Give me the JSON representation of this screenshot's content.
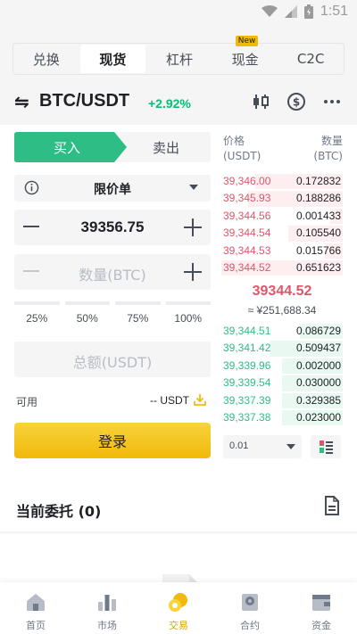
{
  "status_bar": {
    "time": "1:51"
  },
  "tabs": [
    {
      "label": "兑换"
    },
    {
      "label": "现货",
      "active": true
    },
    {
      "label": "杠杆"
    },
    {
      "label": "现金",
      "badge": "New"
    },
    {
      "label": "C2C"
    }
  ],
  "pair": {
    "symbol": "BTC/USDT",
    "change": "+2.92%"
  },
  "trade": {
    "buy_label": "买入",
    "sell_label": "卖出",
    "order_type": "限价单",
    "price_value": "39356.75",
    "amount_placeholder": "数量(BTC)",
    "percentages": [
      "25%",
      "50%",
      "75%",
      "100%"
    ],
    "total_placeholder": "总额(USDT)",
    "available_label": "可用",
    "available_value": "-- USDT",
    "login_label": "登录"
  },
  "orderbook": {
    "price_header": [
      "价格",
      "(USDT)"
    ],
    "qty_header": [
      "数量",
      "(BTC)"
    ],
    "asks": [
      {
        "price": "39,346.00",
        "qty": "0.172832",
        "depth": 0.72
      },
      {
        "price": "39,345.93",
        "qty": "0.188286",
        "depth": 0.78
      },
      {
        "price": "39,344.56",
        "qty": "0.001433",
        "depth": 0.1
      },
      {
        "price": "39,344.54",
        "qty": "0.105540",
        "depth": 0.45
      },
      {
        "price": "39,344.53",
        "qty": "0.015766",
        "depth": 0.15
      },
      {
        "price": "39,344.52",
        "qty": "0.651623",
        "depth": 1.0
      }
    ],
    "mid_price": "39344.52",
    "mid_fiat": "≈ ¥251,688.34",
    "bids": [
      {
        "price": "39,344.51",
        "qty": "0.086729",
        "depth": 0.35
      },
      {
        "price": "39,341.42",
        "qty": "0.509437",
        "depth": 0.6
      },
      {
        "price": "39,339.96",
        "qty": "0.002000",
        "depth": 0.5
      },
      {
        "price": "39,339.54",
        "qty": "0.030000",
        "depth": 0.5
      },
      {
        "price": "39,337.39",
        "qty": "0.329385",
        "depth": 0.5
      },
      {
        "price": "39,337.38",
        "qty": "0.023000",
        "depth": 0.5
      }
    ],
    "precision": "0.01"
  },
  "orders": {
    "title": "当前委托 (0)"
  },
  "nav": [
    {
      "label": "首页",
      "icon": "home-icon"
    },
    {
      "label": "市场",
      "icon": "market-icon"
    },
    {
      "label": "交易",
      "icon": "trade-icon",
      "active": true
    },
    {
      "label": "合约",
      "icon": "futures-icon"
    },
    {
      "label": "资金",
      "icon": "wallet-icon"
    }
  ],
  "colors": {
    "brand": "#f0b90b",
    "buy": "#02c076",
    "sell": "#e15569"
  }
}
